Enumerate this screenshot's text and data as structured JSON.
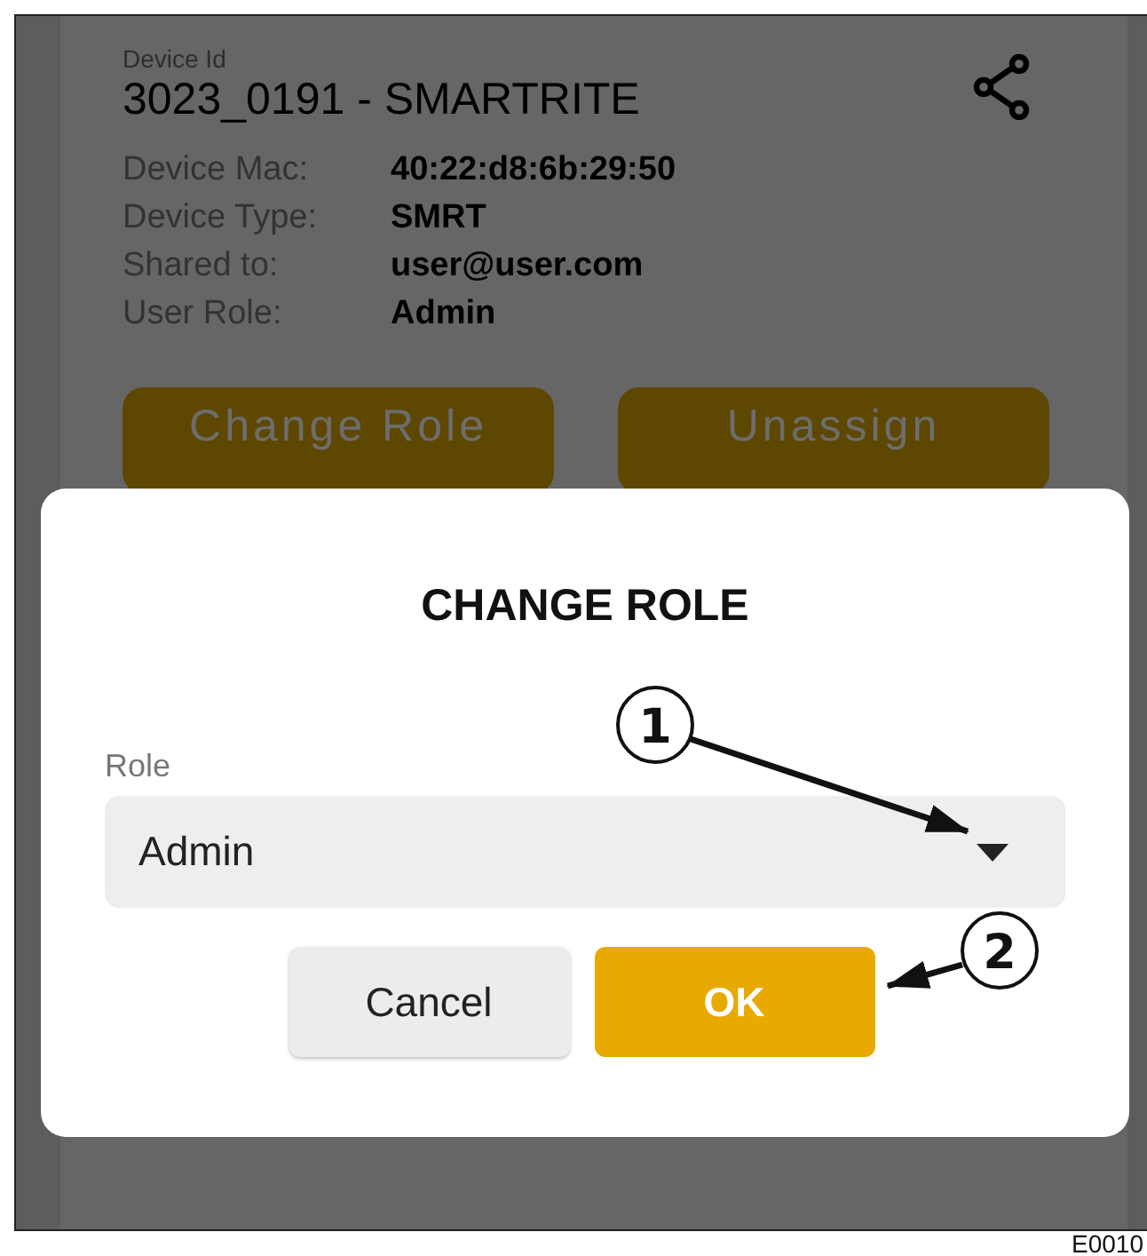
{
  "device": {
    "id_label": "Device Id",
    "title": "3023_0191 - SMARTRITE",
    "fields": [
      {
        "label": "Device Mac:",
        "value": "40:22:d8:6b:29:50"
      },
      {
        "label": "Device Type:",
        "value": "SMRT"
      },
      {
        "label": "Shared to:",
        "value": "user@user.com"
      },
      {
        "label": "User Role:",
        "value": "Admin"
      }
    ],
    "actions": [
      "Change Role",
      "Unassign"
    ]
  },
  "dialog": {
    "title": "CHANGE ROLE",
    "field_label": "Role",
    "value": "Admin",
    "buttons": [
      {
        "label": "Cancel",
        "kind": "secondary"
      },
      {
        "label": "OK",
        "kind": "primary"
      }
    ]
  },
  "callouts": [
    "1",
    "2"
  ],
  "figure_code": "E0010"
}
